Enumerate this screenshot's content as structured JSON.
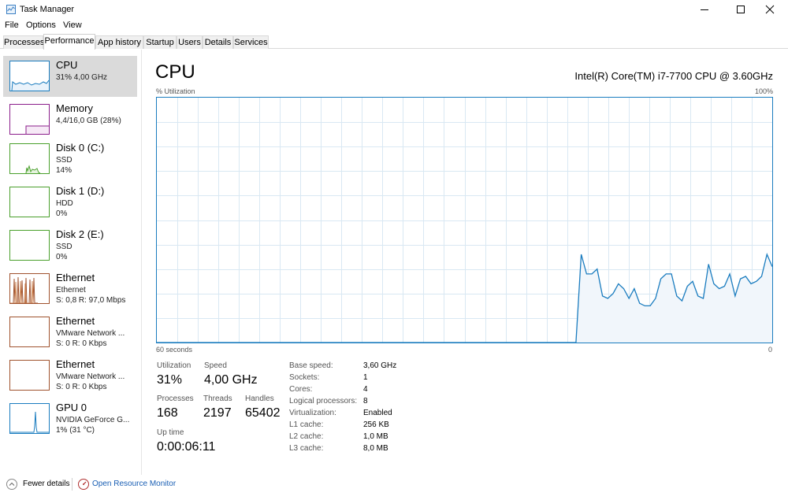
{
  "window": {
    "title": "Task Manager"
  },
  "menu": [
    "File",
    "Options",
    "View"
  ],
  "tabs": [
    {
      "label": "Processes"
    },
    {
      "label": "Performance",
      "active": true
    },
    {
      "label": "App history"
    },
    {
      "label": "Startup"
    },
    {
      "label": "Users"
    },
    {
      "label": "Details"
    },
    {
      "label": "Services"
    }
  ],
  "sidebar": {
    "items": [
      {
        "title": "CPU",
        "sub": "31% 4,00 GHz",
        "sub2": "",
        "color": "#1a7cbf"
      },
      {
        "title": "Memory",
        "sub": "4,4/16,0 GB (28%)",
        "sub2": "",
        "color": "#8b1e8b"
      },
      {
        "title": "Disk 0 (C:)",
        "sub": "SSD",
        "sub2": "14%",
        "color": "#4aa02c"
      },
      {
        "title": "Disk 1 (D:)",
        "sub": "HDD",
        "sub2": "0%",
        "color": "#4aa02c"
      },
      {
        "title": "Disk 2 (E:)",
        "sub": "SSD",
        "sub2": "0%",
        "color": "#4aa02c"
      },
      {
        "title": "Ethernet",
        "sub": "Ethernet",
        "sub2": "S: 0,8  R: 97,0 Mbps",
        "color": "#a0522d"
      },
      {
        "title": "Ethernet",
        "sub": "VMware Network ...",
        "sub2": "S: 0  R: 0 Kbps",
        "color": "#a0522d"
      },
      {
        "title": "Ethernet",
        "sub": "VMware Network ...",
        "sub2": "S: 0  R: 0 Kbps",
        "color": "#a0522d"
      },
      {
        "title": "GPU 0",
        "sub": "NVIDIA GeForce G...",
        "sub2": "1% (31 °C)",
        "color": "#1a7cbf"
      }
    ]
  },
  "main": {
    "heading": "CPU",
    "model": "Intel(R) Core(TM) i7-7700 CPU @ 3.60GHz",
    "util_label": "% Utilization",
    "max_label": "100%",
    "seconds_label": "60 seconds",
    "zero_label": "0",
    "stats": {
      "utilization_label": "Utilization",
      "utilization": "31%",
      "speed_label": "Speed",
      "speed": "4,00 GHz",
      "processes_label": "Processes",
      "processes": "168",
      "threads_label": "Threads",
      "threads": "2197",
      "handles_label": "Handles",
      "handles": "65402",
      "uptime_label": "Up time",
      "uptime": "0:00:06:11"
    },
    "specs": [
      {
        "label": "Base speed:",
        "value": "3,60 GHz"
      },
      {
        "label": "Sockets:",
        "value": "1"
      },
      {
        "label": "Cores:",
        "value": "4"
      },
      {
        "label": "Logical processors:",
        "value": "8"
      },
      {
        "label": "Virtualization:",
        "value": "Enabled"
      },
      {
        "label": "L1 cache:",
        "value": "256 KB"
      },
      {
        "label": "L2 cache:",
        "value": "1,0 MB"
      },
      {
        "label": "L3 cache:",
        "value": "8,0 MB"
      }
    ]
  },
  "footer": {
    "fewer_details": "Fewer details",
    "resource_monitor": "Open Resource Monitor"
  },
  "colors": {
    "cpu_line": "#1a7cbf",
    "cpu_fill": "#f1f6fb",
    "grid": "#d9e8f3"
  },
  "cpu_history": [
    0,
    0,
    0,
    0,
    0,
    0,
    0,
    0,
    0,
    0,
    0,
    0,
    0,
    0,
    0,
    0,
    0,
    0,
    0,
    0,
    0,
    0,
    0,
    0,
    0,
    0,
    0,
    0,
    0,
    0,
    0,
    0,
    0,
    0,
    0,
    0,
    0,
    0,
    0,
    0,
    0,
    0,
    0,
    0,
    0,
    0,
    0,
    0,
    0,
    0,
    0,
    0,
    0,
    0,
    0,
    0,
    0,
    0,
    0,
    0,
    0,
    0,
    0,
    0,
    0,
    0,
    0,
    0,
    0,
    0,
    0,
    0,
    0,
    0,
    0,
    0,
    0,
    0,
    0,
    0,
    36,
    28,
    28,
    30,
    19,
    18,
    20,
    24,
    22,
    18,
    22,
    16,
    15,
    15,
    18,
    26,
    28,
    28,
    19,
    17,
    23,
    25,
    19,
    18,
    32,
    24,
    22,
    23,
    28,
    19,
    26,
    27,
    24,
    25,
    27,
    36,
    31
  ]
}
